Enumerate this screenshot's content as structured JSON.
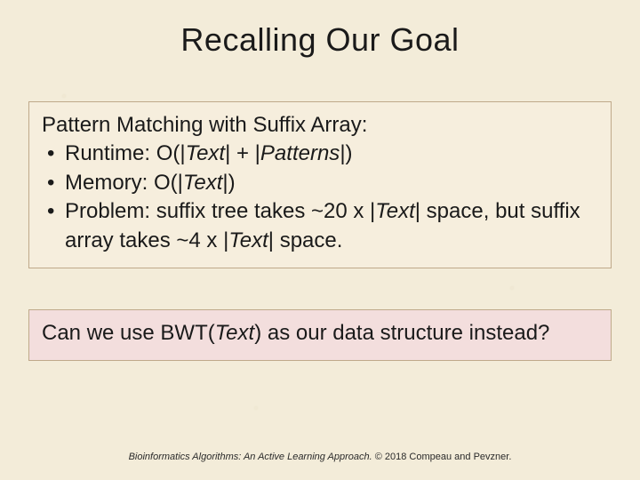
{
  "title": "Recalling Our Goal",
  "box1": {
    "heading": "Pattern Matching with Suffix Array:",
    "items": [
      {
        "pre": "Runtime: O(|",
        "it1": "Text",
        "mid": "| + |",
        "it2": "Patterns",
        "post": "|)"
      },
      {
        "pre": "Memory: O(|",
        "it1": "Text",
        "mid": "",
        "it2": "",
        "post": "|)"
      },
      {
        "pre": "Problem: suffix tree takes ~20 x |",
        "it1": "Text",
        "mid": "| space, but suffix array takes ~4 x |",
        "it2": "Text",
        "post": "| space."
      }
    ]
  },
  "box2": {
    "pre": "Can we use BWT(",
    "it": "Text",
    "post": ") as our data structure instead?"
  },
  "footer": {
    "book": "Bioinformatics Algorithms: An Active Learning Approach.",
    "rights": " © 2018 Compeau and Pevzner."
  }
}
